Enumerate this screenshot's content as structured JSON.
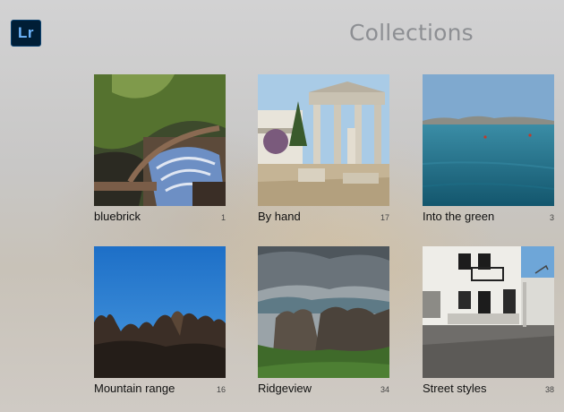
{
  "header": {
    "logo_text": "Lr",
    "title": "Collections"
  },
  "collections": [
    {
      "name": "bluebrick",
      "count": "1"
    },
    {
      "name": "By hand",
      "count": "17"
    },
    {
      "name": "Into the green",
      "count": "3"
    },
    {
      "name": "Mountain range",
      "count": "16"
    },
    {
      "name": "Ridgeview",
      "count": "34"
    },
    {
      "name": "Street styles",
      "count": "38"
    }
  ]
}
